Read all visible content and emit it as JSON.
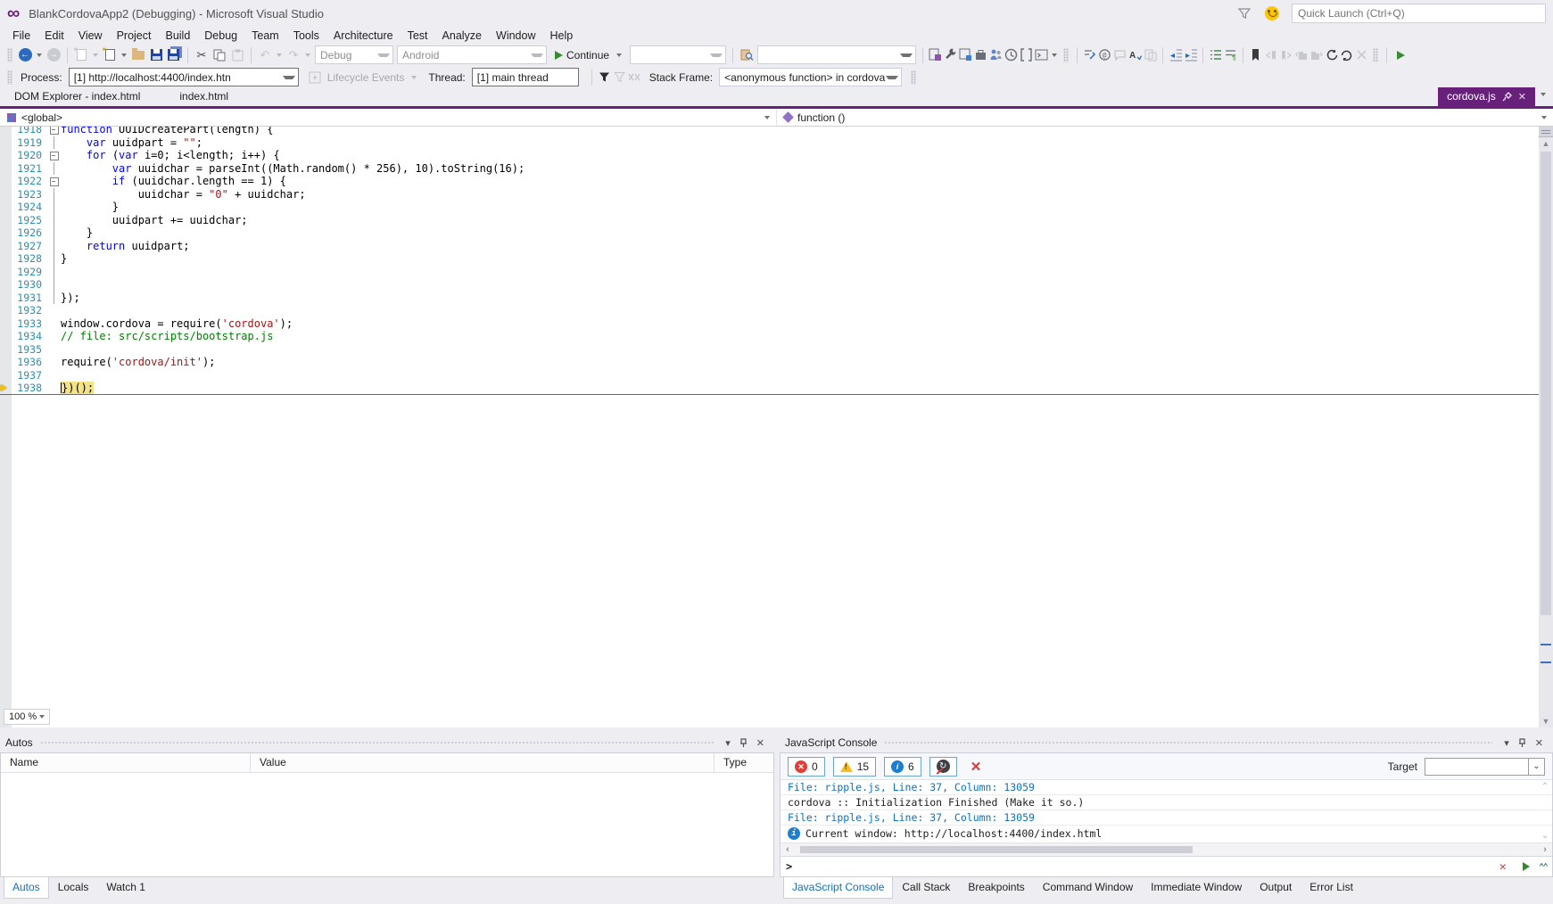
{
  "window": {
    "title": "BlankCordovaApp2 (Debugging) - Microsoft Visual Studio",
    "quick_launch_placeholder": "Quick Launch (Ctrl+Q)"
  },
  "menu": {
    "items": [
      "File",
      "Edit",
      "View",
      "Project",
      "Build",
      "Debug",
      "Team",
      "Tools",
      "Architecture",
      "Test",
      "Analyze",
      "Window",
      "Help"
    ]
  },
  "toolbar": {
    "solution_configuration": "Debug",
    "solution_platform": "Android",
    "continue_label": "Continue"
  },
  "debugbar": {
    "process_label": "Process:",
    "process_value": "[1] http://localhost:4400/index.htn",
    "lifecycle_label": "Lifecycle Events",
    "thread_label": "Thread:",
    "thread_value": "[1] main thread",
    "stack_frame_label": "Stack Frame:",
    "stack_frame_value": "<anonymous function> in cordova.js, line"
  },
  "tabs": {
    "left": [
      "DOM Explorer - index.html",
      "index.html"
    ],
    "right_active": "cordova.js"
  },
  "navbar": {
    "scope": "<global>",
    "member": "function ()"
  },
  "editor": {
    "zoom_level": "100 %",
    "lines": [
      {
        "n": "1918",
        "o": "box",
        "t": [
          [
            "k",
            "function"
          ],
          [
            "p",
            " UUIDcreatePart(length) {"
          ]
        ]
      },
      {
        "n": "1919",
        "o": "line",
        "t": [
          [
            "p",
            "    "
          ],
          [
            "k",
            "var"
          ],
          [
            "p",
            " uuidpart = "
          ],
          [
            "s",
            "\"\""
          ],
          [
            "p",
            ";"
          ]
        ]
      },
      {
        "n": "1920",
        "o": "box",
        "t": [
          [
            "p",
            "    "
          ],
          [
            "k",
            "for"
          ],
          [
            "p",
            " ("
          ],
          [
            "k",
            "var"
          ],
          [
            "p",
            " i=0; i<length; i++) {"
          ]
        ]
      },
      {
        "n": "1921",
        "o": "line",
        "t": [
          [
            "p",
            "        "
          ],
          [
            "k",
            "var"
          ],
          [
            "p",
            " uuidchar = parseInt((Math.random() * 256), 10).toString(16);"
          ]
        ]
      },
      {
        "n": "1922",
        "o": "box",
        "t": [
          [
            "p",
            "        "
          ],
          [
            "k",
            "if"
          ],
          [
            "p",
            " (uuidchar.length == 1) {"
          ]
        ]
      },
      {
        "n": "1923",
        "o": "line",
        "t": [
          [
            "p",
            "            uuidchar = "
          ],
          [
            "s",
            "\"0\""
          ],
          [
            "p",
            " + uuidchar;"
          ]
        ]
      },
      {
        "n": "1924",
        "o": "line",
        "t": [
          [
            "p",
            "        }"
          ]
        ]
      },
      {
        "n": "1925",
        "o": "line",
        "t": [
          [
            "p",
            "        uuidpart += uuidchar;"
          ]
        ]
      },
      {
        "n": "1926",
        "o": "line",
        "t": [
          [
            "p",
            "    }"
          ]
        ]
      },
      {
        "n": "1927",
        "o": "line",
        "t": [
          [
            "p",
            "    "
          ],
          [
            "k",
            "return"
          ],
          [
            "p",
            " uuidpart;"
          ]
        ]
      },
      {
        "n": "1928",
        "o": "line",
        "t": [
          [
            "p",
            "}"
          ]
        ]
      },
      {
        "n": "1929",
        "o": "line",
        "t": []
      },
      {
        "n": "1930",
        "o": "line",
        "t": []
      },
      {
        "n": "1931",
        "o": "line",
        "t": [
          [
            "p",
            "});"
          ]
        ]
      },
      {
        "n": "1932",
        "o": "",
        "t": []
      },
      {
        "n": "1933",
        "o": "",
        "t": [
          [
            "p",
            "window.cordova = require("
          ],
          [
            "s",
            "'cordova'"
          ],
          [
            "p",
            ");"
          ]
        ]
      },
      {
        "n": "1934",
        "o": "",
        "t": [
          [
            "c",
            "// file: src/scripts/bootstrap.js"
          ]
        ]
      },
      {
        "n": "1935",
        "o": "",
        "t": []
      },
      {
        "n": "1936",
        "o": "",
        "t": [
          [
            "p",
            "require("
          ],
          [
            "s",
            "'cordova/init'"
          ],
          [
            "p",
            ");"
          ]
        ]
      },
      {
        "n": "1937",
        "o": "",
        "t": []
      },
      {
        "n": "1938",
        "o": "",
        "cur": true,
        "t": [
          [
            "p",
            "})();"
          ]
        ]
      }
    ]
  },
  "autos": {
    "title": "Autos",
    "columns": [
      "Name",
      "Value",
      "Type"
    ],
    "tabs": [
      "Autos",
      "Locals",
      "Watch 1"
    ],
    "active_tab": "Autos"
  },
  "console": {
    "title": "JavaScript Console",
    "counts": {
      "errors": "0",
      "warnings": "15",
      "messages": "6"
    },
    "target_label": "Target",
    "rows": [
      {
        "type": "file",
        "text": "File: ripple.js, Line: 37, Column: 13059"
      },
      {
        "type": "plain",
        "text": "cordova :: Initialization Finished (Make it so.)"
      },
      {
        "type": "file",
        "text": "File: ripple.js, Line: 37, Column: 13059"
      },
      {
        "type": "info",
        "text": "Current window: http://localhost:4400/index.html"
      }
    ],
    "prompt": ">",
    "tabs": [
      "JavaScript Console",
      "Call Stack",
      "Breakpoints",
      "Command Window",
      "Immediate Window",
      "Output",
      "Error List"
    ],
    "active_tab": "JavaScript Console"
  },
  "colors": {
    "accent_purple": "#68217a",
    "line_number_blue": "#2b91af",
    "keyword_blue": "#0000ff",
    "string_red": "#a31515",
    "comment_green": "#008000",
    "console_link_blue": "#0e70c0",
    "current_statement_yellow": "#f3e286",
    "continue_green": "#388a34"
  }
}
